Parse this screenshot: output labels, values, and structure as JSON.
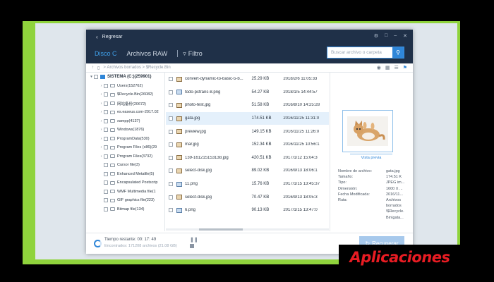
{
  "titlebar": {
    "back_label": "Regresar"
  },
  "tabs": [
    {
      "label": "Disco C"
    },
    {
      "label": "Archivos RAW"
    }
  ],
  "filter_label": "Filtro",
  "search": {
    "placeholder": "Buscar archivo o carpeta"
  },
  "path": {
    "seg1": "Archivos borrados",
    "seg2": "$Recycle.Bin"
  },
  "tree": {
    "root": "SISTEMA (C:)(259901)",
    "items": [
      {
        "label": "Users(152762)"
      },
      {
        "label": "$Recycle.Bin(26082)"
      },
      {
        "label": "网站备份(20672)"
      },
      {
        "label": "es.easeus.com-2017.02"
      },
      {
        "label": "xampp(4137)"
      },
      {
        "label": "Windows(1876)"
      },
      {
        "label": "ProgramData(530)"
      },
      {
        "label": "Program Files (x86)(29"
      },
      {
        "label": "Program Files(3732)"
      },
      {
        "label": "Cursor file(3)"
      },
      {
        "label": "Enhanced Metafile(5)"
      },
      {
        "label": "Encapsulated Postscrip"
      },
      {
        "label": "WMF Multimedia file(1"
      },
      {
        "label": "GIF graphics file(223)"
      },
      {
        "label": "Bitmap file(134)"
      }
    ]
  },
  "files": [
    {
      "name": "convert-dynamic-to-basic-5-b...",
      "size": "25.29 KB",
      "date": "2018/2/6 11:05:33",
      "type": "jpg"
    },
    {
      "name": "todo-pctrans-8.png",
      "size": "54.27 KB",
      "date": "2018/1/5 14:44:57",
      "type": "png"
    },
    {
      "name": "photo-test.jpg",
      "size": "51.58 KB",
      "date": "2016/8/10 14:25:28",
      "type": "jpg"
    },
    {
      "name": "gata.jpg",
      "size": "174.51 KB",
      "date": "2016/11/25 11:31:0",
      "type": "jpg"
    },
    {
      "name": "preview.jpg",
      "size": "149.15 KB",
      "date": "2016/11/25 11:26:0",
      "type": "jpg"
    },
    {
      "name": "mar.jpg",
      "size": "152.34 KB",
      "date": "2016/11/25 10:56:1",
      "type": "jpg"
    },
    {
      "name": "139-161215153138.jpg",
      "size": "420.51 KB",
      "date": "2017/1/12 15:04:3",
      "type": "jpg"
    },
    {
      "name": "select-disk.jpg",
      "size": "89.02 KB",
      "date": "2016/9/13 18:06:1",
      "type": "jpg"
    },
    {
      "name": "11.png",
      "size": "15.76 KB",
      "date": "2017/1/15 13:45:37",
      "type": "png"
    },
    {
      "name": "select-disk.jpg",
      "size": "70.47 KB",
      "date": "2016/9/13 18:05:3",
      "type": "jpg"
    },
    {
      "name": "6.png",
      "size": "90.13 KB",
      "date": "2017/1/15 13:47:0",
      "type": "png"
    }
  ],
  "preview": {
    "vista_label": "Vista previa",
    "props": [
      {
        "label": "Nombre de archivo:",
        "value": "gata.jpg"
      },
      {
        "label": "Tamaño:",
        "value": "174.51 K"
      },
      {
        "label": "Tipo:",
        "value": "JPEG im..."
      },
      {
        "label": "Dimensión:",
        "value": "1600 X ..."
      },
      {
        "label": "Fecha Modificada:",
        "value": "2016/11..."
      },
      {
        "label": "Ruta:",
        "value": "Archivos"
      },
      {
        "label": "",
        "value": "borrados"
      },
      {
        "label": "",
        "value": "\\$Recycle."
      },
      {
        "label": "",
        "value": "Bin\\gata..."
      }
    ]
  },
  "footer": {
    "time_left": "Tiempo restante: 00: 17: 49",
    "found": "Encontrados: 171208 archivos (21.08 GB)",
    "recover_label": "Recuperar"
  },
  "badge_label": "Aplicaciones"
}
